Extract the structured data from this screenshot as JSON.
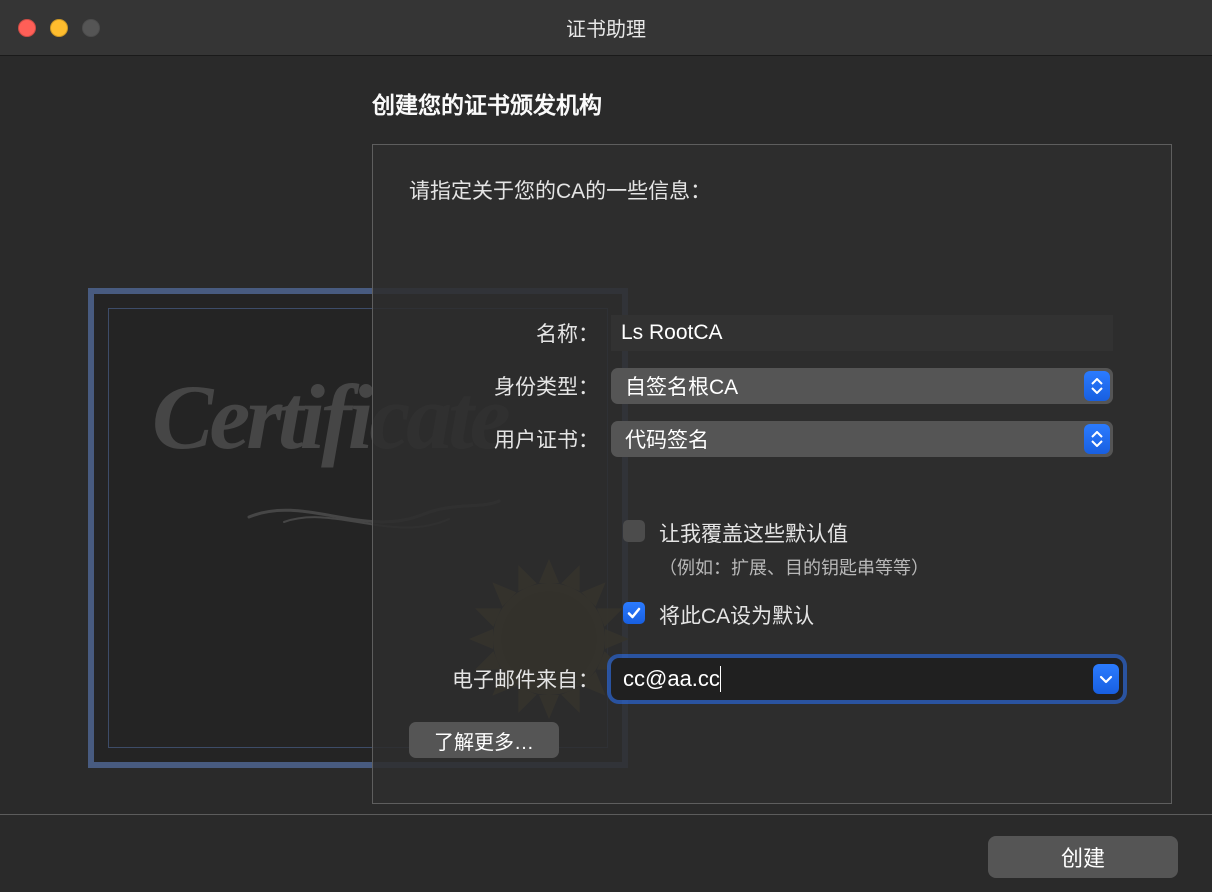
{
  "window": {
    "title": "证书助理"
  },
  "header": {
    "page_title": "创建您的证书颁发机构"
  },
  "form": {
    "instruction": "请指定关于您的CA的一些信息：",
    "name_label": "名称：",
    "name_value": "Ls RootCA",
    "identity_label": "身份类型：",
    "identity_value": "自签名根CA",
    "usercert_label": "用户证书：",
    "usercert_value": "代码签名",
    "override_label": "让我覆盖这些默认值",
    "override_sub": "（例如：扩展、目的钥匙串等等）",
    "default_ca_label": "将此CA设为默认",
    "email_label": "电子邮件来自：",
    "email_value": "cc@aa.cc",
    "learn_more_label": "了解更多…",
    "override_checked": false,
    "default_ca_checked": true
  },
  "footer": {
    "create_label": "创建"
  },
  "colors": {
    "accent": "#1f6fff",
    "panel_border": "#5e5e5e",
    "text": "#e4e4e4"
  },
  "cert_art": {
    "word": "Certificate"
  }
}
